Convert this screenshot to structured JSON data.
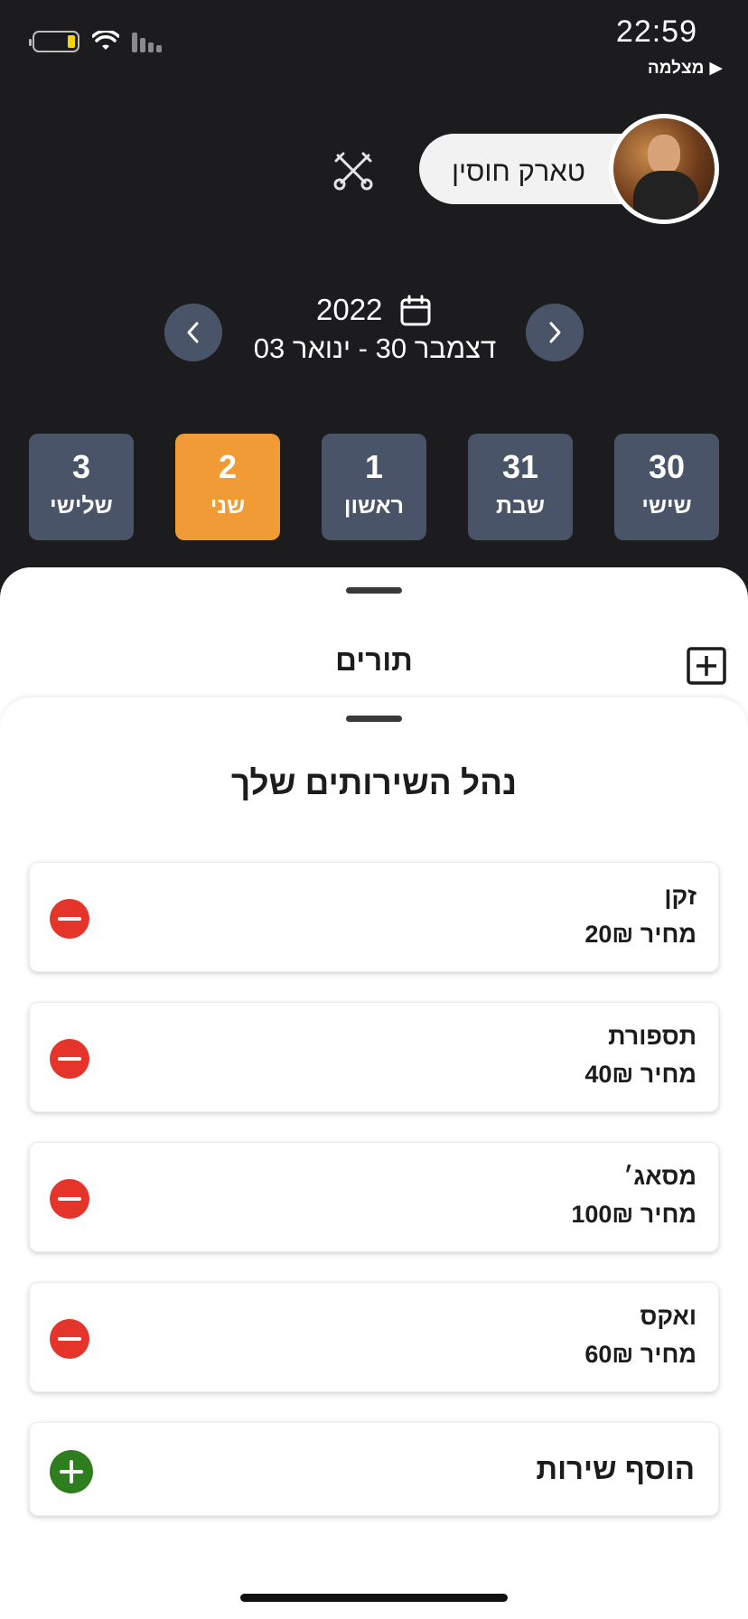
{
  "status_bar": {
    "time": "22:59",
    "back_app": "מצלמה"
  },
  "header": {
    "user_name": "טארק חוסין"
  },
  "date_nav": {
    "year": "2022",
    "range": "דצמבר 30 - ינואר 03"
  },
  "days": [
    {
      "num": "30",
      "name": "שישי"
    },
    {
      "num": "31",
      "name": "שבת"
    },
    {
      "num": "1",
      "name": "ראשון"
    },
    {
      "num": "2",
      "name": "שני"
    },
    {
      "num": "3",
      "name": "שלישי"
    }
  ],
  "selected_day": "2",
  "sheet": {
    "title": "תורים"
  },
  "services_panel": {
    "title": "נהל השירותים שלך",
    "services": [
      {
        "name": "זקן",
        "price": "מחיר 20₪"
      },
      {
        "name": "תספורת",
        "price": "מחיר 40₪"
      },
      {
        "name": "מסאג׳",
        "price": "מחיר 100₪"
      },
      {
        "name": "ואקס",
        "price": "מחיר 60₪"
      }
    ],
    "add_label": "הוסף שירות"
  },
  "colors": {
    "background": "#1c1c1e",
    "day_tile": "#4a5468",
    "day_active": "#f09b35",
    "remove": "#e5352a",
    "add": "#2e7d1f"
  }
}
